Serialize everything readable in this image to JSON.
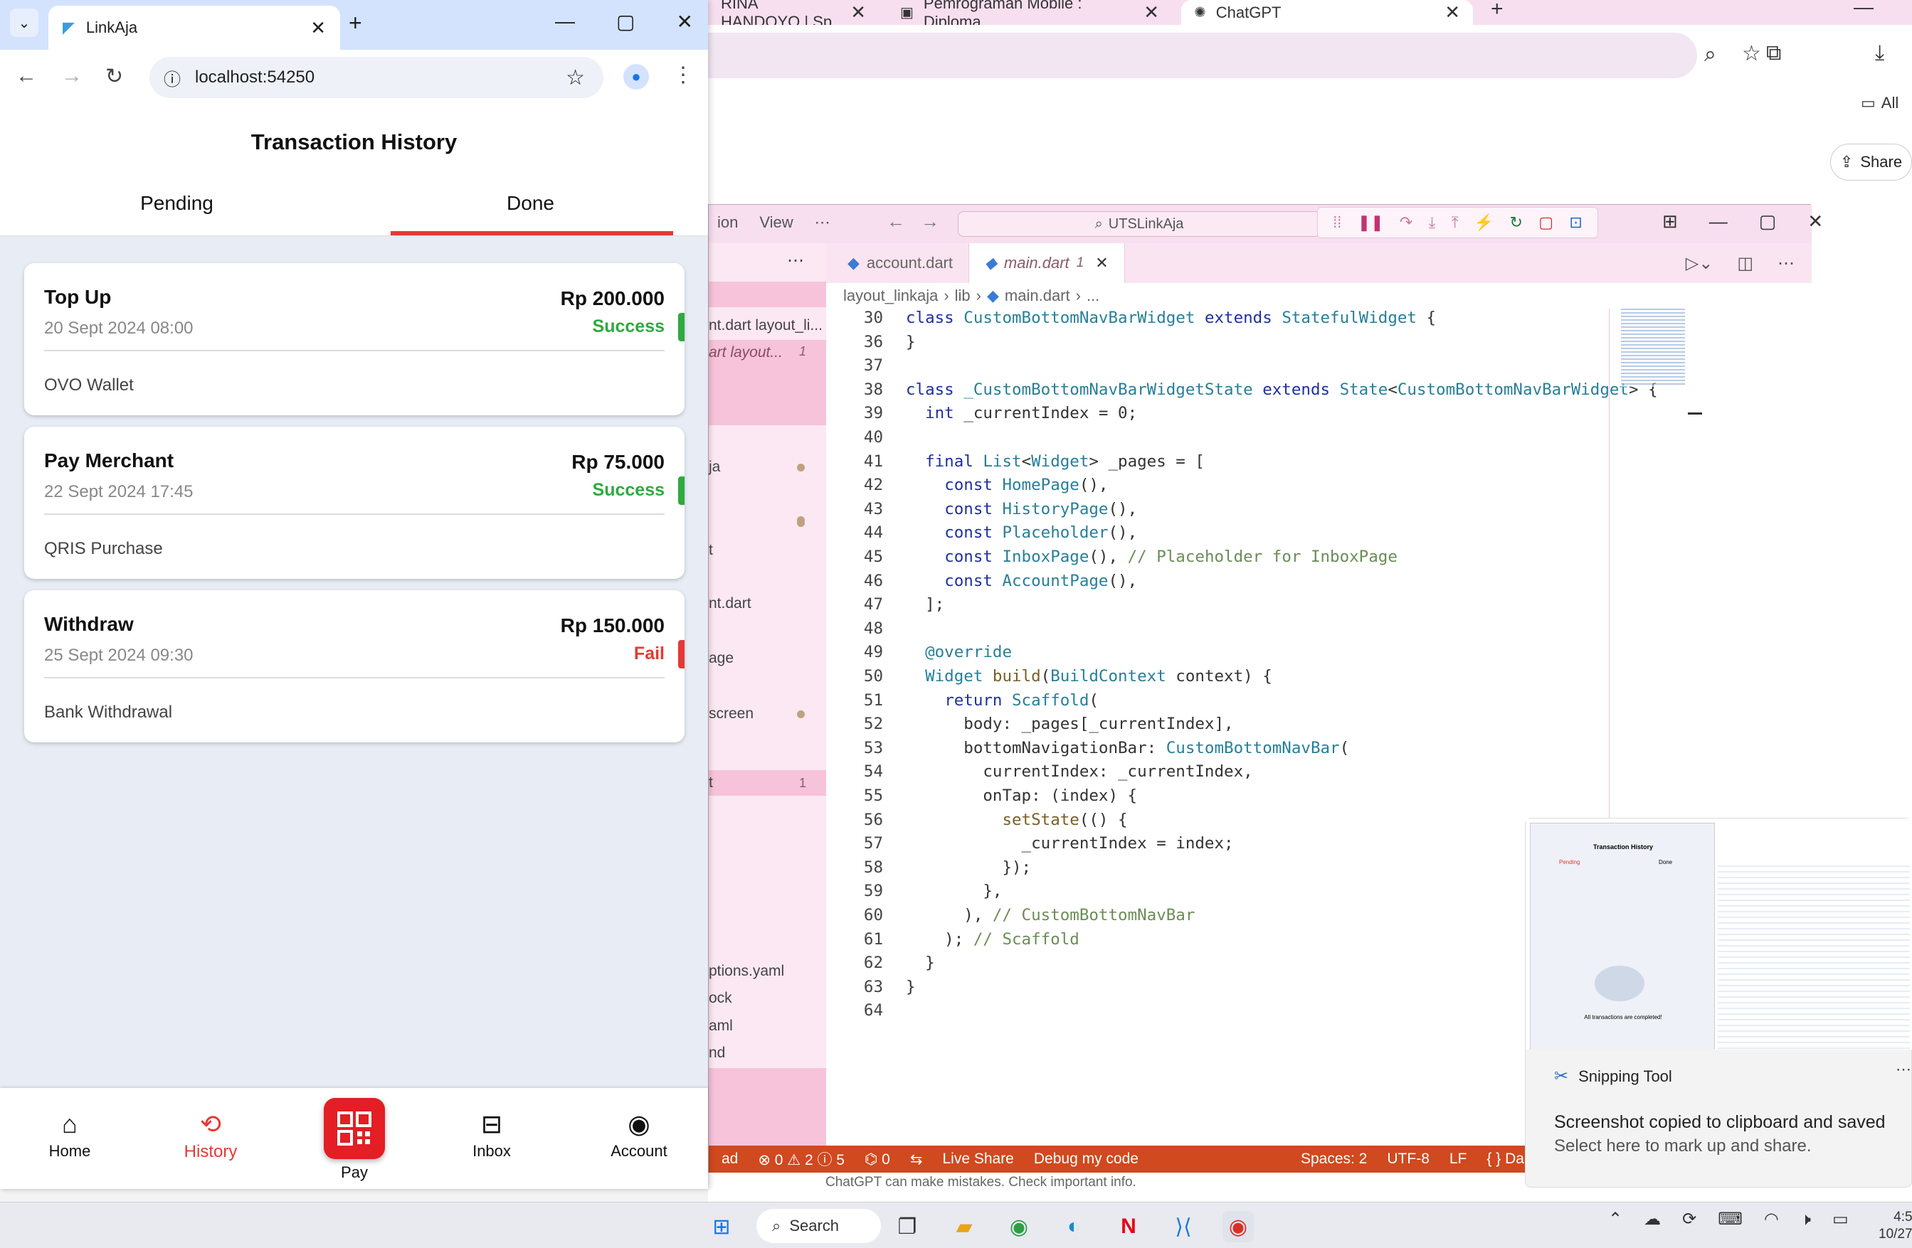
{
  "bg_chrome": {
    "tabs": [
      {
        "label": "RINA HANDOYO | Sp"
      },
      {
        "label": "Pemrograman Mobile : Diploma"
      },
      {
        "label": "ChatGPT"
      }
    ],
    "share_label": "Share",
    "bookmarks_label": "All",
    "disclaimer": "ChatGPT can make mistakes. Check important info."
  },
  "vscode": {
    "menu": [
      "ion",
      "View",
      "⋯"
    ],
    "search": "UTSLinkAja",
    "explorer_items": [
      {
        "label": "nt.dart layout_li...",
        "badge": ""
      },
      {
        "label": "art  layout...",
        "badge": "1"
      },
      {
        "label": "ja",
        "badge": "•"
      },
      {
        "label": "t",
        "badge": ""
      },
      {
        "label": "nt.dart",
        "badge": ""
      },
      {
        "label": "age",
        "badge": ""
      },
      {
        "label": "screen",
        "badge": "•"
      },
      {
        "label": "t",
        "badge": "1"
      },
      {
        "label": "ptions.yaml",
        "badge": ""
      },
      {
        "label": "ock",
        "badge": ""
      },
      {
        "label": "aml",
        "badge": ""
      },
      {
        "label": "nd",
        "badge": ""
      }
    ],
    "tabs": [
      {
        "label": "account.dart"
      },
      {
        "label": "main.dart",
        "badge": "1"
      }
    ],
    "breadcrumb": [
      "layout_linkaja",
      "lib",
      "main.dart",
      "..."
    ],
    "code_lines": [
      {
        "n": "30",
        "t": "class CustomBottomNavBarWidget extends StatefulWidget {"
      },
      {
        "n": "36",
        "t": "}"
      },
      {
        "n": "37",
        "t": ""
      },
      {
        "n": "38",
        "t": "class _CustomBottomNavBarWidgetState extends State<CustomBottomNavBarWidget> {"
      },
      {
        "n": "39",
        "t": "  int _currentIndex = 0;"
      },
      {
        "n": "40",
        "t": ""
      },
      {
        "n": "41",
        "t": "  final List<Widget> _pages = ["
      },
      {
        "n": "42",
        "t": "    const HomePage(),"
      },
      {
        "n": "43",
        "t": "    const HistoryPage(),"
      },
      {
        "n": "44",
        "t": "    const Placeholder(),"
      },
      {
        "n": "45",
        "t": "    const InboxPage(), // Placeholder for InboxPage"
      },
      {
        "n": "46",
        "t": "    const AccountPage(),"
      },
      {
        "n": "47",
        "t": "  ];"
      },
      {
        "n": "48",
        "t": ""
      },
      {
        "n": "49",
        "t": "  @override"
      },
      {
        "n": "50",
        "t": "  Widget build(BuildContext context) {"
      },
      {
        "n": "51",
        "t": "    return Scaffold("
      },
      {
        "n": "52",
        "t": "      body: _pages[_currentIndex],"
      },
      {
        "n": "53",
        "t": "      bottomNavigationBar: CustomBottomNavBar("
      },
      {
        "n": "54",
        "t": "        currentIndex: _currentIndex,"
      },
      {
        "n": "55",
        "t": "        onTap: (index) {"
      },
      {
        "n": "56",
        "t": "          setState(() {"
      },
      {
        "n": "57",
        "t": "            _currentIndex = index;"
      },
      {
        "n": "58",
        "t": "          });"
      },
      {
        "n": "59",
        "t": "        },"
      },
      {
        "n": "60",
        "t": "      ), // CustomBottomNavBar"
      },
      {
        "n": "61",
        "t": "    ); // Scaffold"
      },
      {
        "n": "62",
        "t": "  }"
      },
      {
        "n": "63",
        "t": "}"
      },
      {
        "n": "64",
        "t": ""
      }
    ],
    "status": {
      "left": "ad",
      "problems": "⊗ 0 ⚠ 2 ⓘ 5",
      "ports": "⌬ 0",
      "live_share": "Live Share",
      "debug": "Debug my code",
      "spaces": "Spaces: 2",
      "encoding": "UTF-8",
      "eol": "LF",
      "language": "{ } Dart"
    }
  },
  "snipping": {
    "app": "Snipping Tool",
    "message": "Screenshot copied to clipboard and saved",
    "sub": "Select here to mark up and share.",
    "thumb_title": "Transaction History",
    "thumb_tabs": [
      "Pending",
      "Done"
    ],
    "thumb_empty": "All transactions are completed!"
  },
  "taskbar": {
    "search": "Search",
    "clock_time": "4:5",
    "clock_date": "10/27"
  },
  "linkaja": {
    "tab_title": "LinkAja",
    "url": "localhost:54250",
    "title": "Transaction History",
    "tabs": [
      "Pending",
      "Done"
    ],
    "active_tab": "Done",
    "colors": {
      "accent": "#e53935",
      "success": "#2eaa3f",
      "fail": "#e53935",
      "brand": "#e31e24"
    },
    "transactions": [
      {
        "title": "Top Up",
        "date": "20 Sept 2024 08:00",
        "amount": "Rp 200.000",
        "status": "Success",
        "desc": "OVO Wallet"
      },
      {
        "title": "Pay Merchant",
        "date": "22 Sept 2024 17:45",
        "amount": "Rp 75.000",
        "status": "Success",
        "desc": "QRIS Purchase"
      },
      {
        "title": "Withdraw",
        "date": "25 Sept 2024 09:30",
        "amount": "Rp 150.000",
        "status": "Fail",
        "desc": "Bank Withdrawal"
      }
    ],
    "nav": [
      {
        "label": "Home",
        "icon": "home-icon"
      },
      {
        "label": "History",
        "icon": "history-icon"
      },
      {
        "label": "Pay",
        "icon": "qr-code-icon"
      },
      {
        "label": "Inbox",
        "icon": "inbox-icon"
      },
      {
        "label": "Account",
        "icon": "account-icon"
      }
    ]
  }
}
